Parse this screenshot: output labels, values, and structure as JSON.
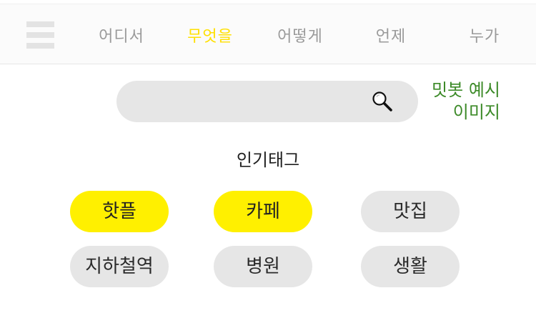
{
  "nav": {
    "tabs": [
      {
        "label": "어디서",
        "active": false
      },
      {
        "label": "무엇을",
        "active": true
      },
      {
        "label": "어떻게",
        "active": false
      },
      {
        "label": "언제",
        "active": false
      },
      {
        "label": "누가",
        "active": false
      }
    ],
    "active_color": "#ffe000"
  },
  "search": {
    "value": "",
    "icon": "magnifier-icon"
  },
  "note": {
    "line1": "밋봇 예시",
    "line2": "이미지"
  },
  "popular": {
    "title": "인기태그",
    "tags": [
      {
        "label": "핫플",
        "selected": true
      },
      {
        "label": "카페",
        "selected": true
      },
      {
        "label": "맛집",
        "selected": false
      },
      {
        "label": "지하철역",
        "selected": false
      },
      {
        "label": "병원",
        "selected": false
      },
      {
        "label": "생활",
        "selected": false
      }
    ],
    "selected_color": "#fff000"
  }
}
